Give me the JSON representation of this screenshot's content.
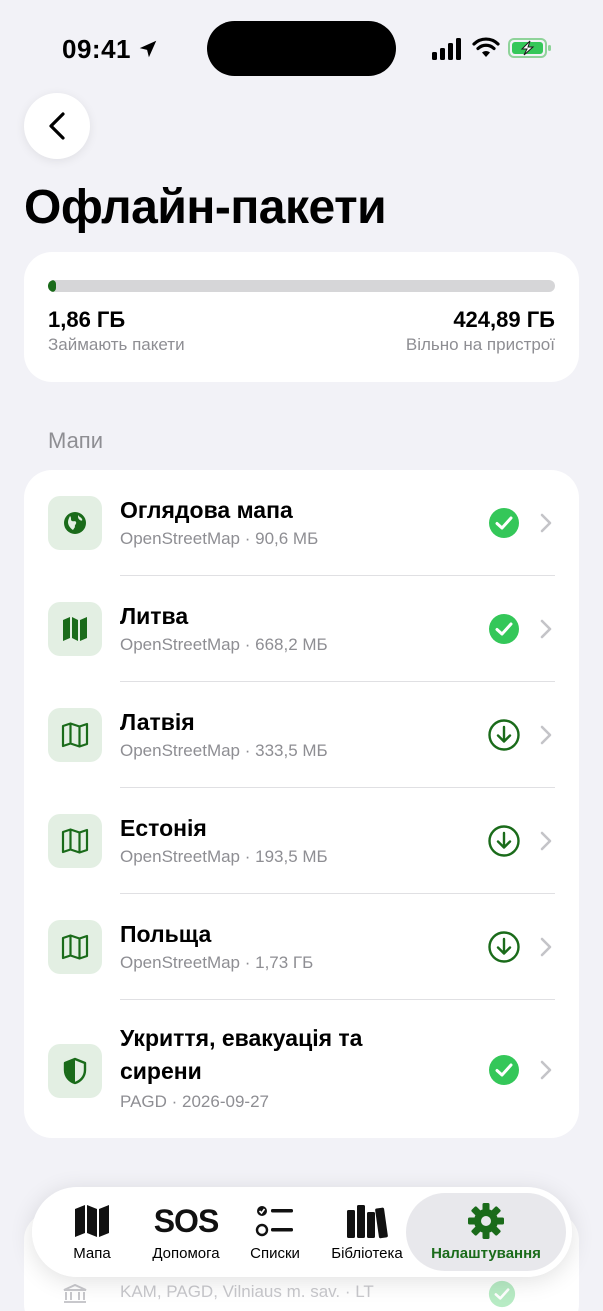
{
  "status_bar": {
    "time": "09:41"
  },
  "page": {
    "title": "Офлайн-пакети"
  },
  "storage": {
    "used_value": "1,86 ГБ",
    "used_label": "Займають пакети",
    "free_value": "424,89 ГБ",
    "free_label": "Вільно на пристрої",
    "used_fraction": 0.0044
  },
  "maps_section": {
    "title": "Мапи",
    "items": [
      {
        "title": "Оглядова мапа",
        "subtitle": "OpenStreetMap · 90,6 МБ",
        "icon": "globe-icon",
        "status": "downloaded"
      },
      {
        "title": "Литва",
        "subtitle": "OpenStreetMap · 668,2 МБ",
        "icon": "map-filled-icon",
        "status": "downloaded"
      },
      {
        "title": "Латвія",
        "subtitle": "OpenStreetMap · 333,5 МБ",
        "icon": "map-outline-icon",
        "status": "available"
      },
      {
        "title": "Естонія",
        "subtitle": "OpenStreetMap · 193,5 МБ",
        "icon": "map-outline-icon",
        "status": "available"
      },
      {
        "title": "Польща",
        "subtitle": "OpenStreetMap · 1,73 ГБ",
        "icon": "map-outline-icon",
        "status": "available"
      },
      {
        "title": "Укриття, евакуація та сирени",
        "subtitle": "PAGD · 2026-09-27",
        "icon": "shield-icon",
        "status": "downloaded"
      }
    ]
  },
  "peek": {
    "subtitle": "KAM, PAGD, Vilniaus m. sav. · LT"
  },
  "tab_bar": {
    "tabs": [
      {
        "label": "Мапа",
        "icon": "map-icon",
        "active": false
      },
      {
        "label": "Допомога",
        "icon": "sos-icon",
        "icon_text": "SOS",
        "active": false
      },
      {
        "label": "Списки",
        "icon": "checklist-icon",
        "active": false
      },
      {
        "label": "Бібліотека",
        "icon": "books-icon",
        "active": false
      },
      {
        "label": "Налаштування",
        "icon": "gear-icon",
        "active": true
      }
    ]
  },
  "colors": {
    "accent": "#1a6b1a",
    "success": "#34c759",
    "background": "#f2f2f7"
  }
}
